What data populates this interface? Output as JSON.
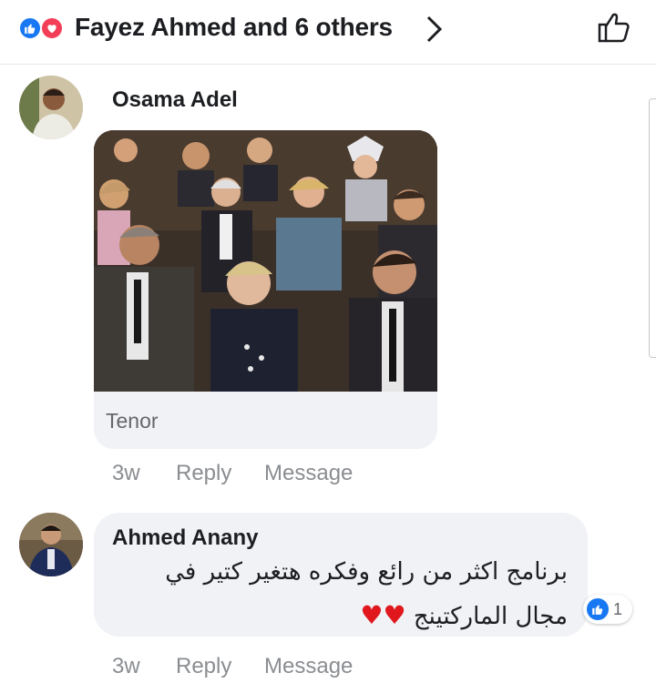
{
  "header": {
    "reactions": [
      "like-icon",
      "love-icon"
    ],
    "title": "Fayez Ahmed and 6 others",
    "chevron": "chevron-right-icon",
    "like_button": "thumbs-up-icon"
  },
  "comments": [
    {
      "author": "Osama Adel",
      "gif_source": "Tenor",
      "time": "3w",
      "reply_label": "Reply",
      "message_label": "Message"
    },
    {
      "author": "Ahmed Anany",
      "text_line1": "برنامج اكثر من رائع وفكره هتغير كتير في",
      "text_line2": "مجال الماركتينج",
      "hearts": "♥♥",
      "reaction_count": "1",
      "time": "3w",
      "reply_label": "Reply",
      "message_label": "Message"
    }
  ],
  "colors": {
    "accent": "#1877f2",
    "love": "#f33e58",
    "heart": "#e0181e",
    "bubble": "#f0f2f5",
    "muted": "#8a8d91"
  }
}
